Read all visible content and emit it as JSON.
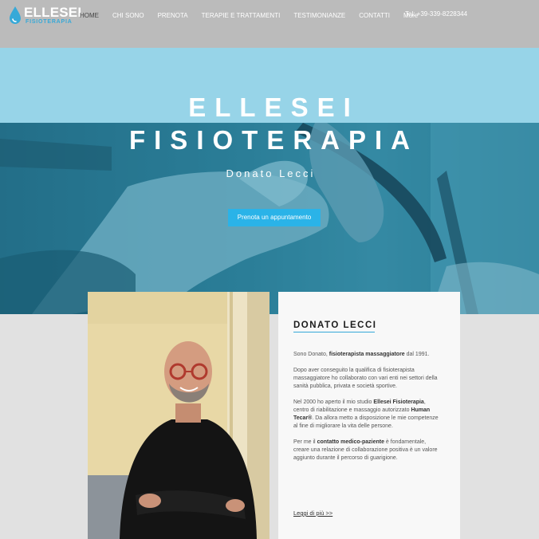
{
  "header": {
    "logo_title": "ELLESEI",
    "logo_subtitle": "FISIOTERAPIA",
    "nav": [
      {
        "label": "HOME",
        "active": true
      },
      {
        "label": "CHI SONO"
      },
      {
        "label": "PRENOTA"
      },
      {
        "label": "TERAPIE E TRATTAMENTI"
      },
      {
        "label": "TESTIMONIANZE"
      },
      {
        "label": "CONTATTI"
      },
      {
        "label": "More"
      }
    ],
    "phone": "Tel: +39-339-8228344"
  },
  "hero": {
    "title_line1": "ELLESEI",
    "title_line2": "FISIOTERAPIA",
    "subtitle": "Donato Lecci",
    "button_label": "Prenota un appuntamento"
  },
  "about": {
    "title": "DONATO LECCI",
    "p1": [
      {
        "t": "Sono Donato, ",
        "b": false
      },
      {
        "t": "fisioterapista massaggiatore",
        "b": true
      },
      {
        "t": " dal 1991.",
        "b": false
      }
    ],
    "p2": [
      {
        "t": "Dopo aver conseguito la qualifica di fisioterapista massaggiatore ho collaborato con vari enti nei settori della sanità pubblica, privata e società sportive.",
        "b": false
      }
    ],
    "p3": [
      {
        "t": "Nel 2000 ho aperto il mio studio ",
        "b": false
      },
      {
        "t": "Ellesei Fisioterapia",
        "b": true
      },
      {
        "t": ", centro di riabilitazione e massaggio autorizzato ",
        "b": false
      },
      {
        "t": "Human Tecar®",
        "b": true
      },
      {
        "t": ". Da allora metto a disposizione le mie competenze al fine di migliorare la vita delle persone.",
        "b": false
      }
    ],
    "p4": [
      {
        "t": "Per me il ",
        "b": false
      },
      {
        "t": "contatto medico-paziente",
        "b": true
      },
      {
        "t": " è fondamentale, creare una relazione di collaborazione positiva è un valore aggiunto durante il percorso di guarigione.",
        "b": false
      }
    ],
    "link_label": "Leggi di più >>"
  },
  "colors": {
    "accent": "#2ab3e8",
    "header_bg": "#bbbbbb",
    "hero_light": "#97d4e8",
    "hero_dark": "#1f6680"
  },
  "icons": {
    "logo": "water-drop-icon"
  }
}
